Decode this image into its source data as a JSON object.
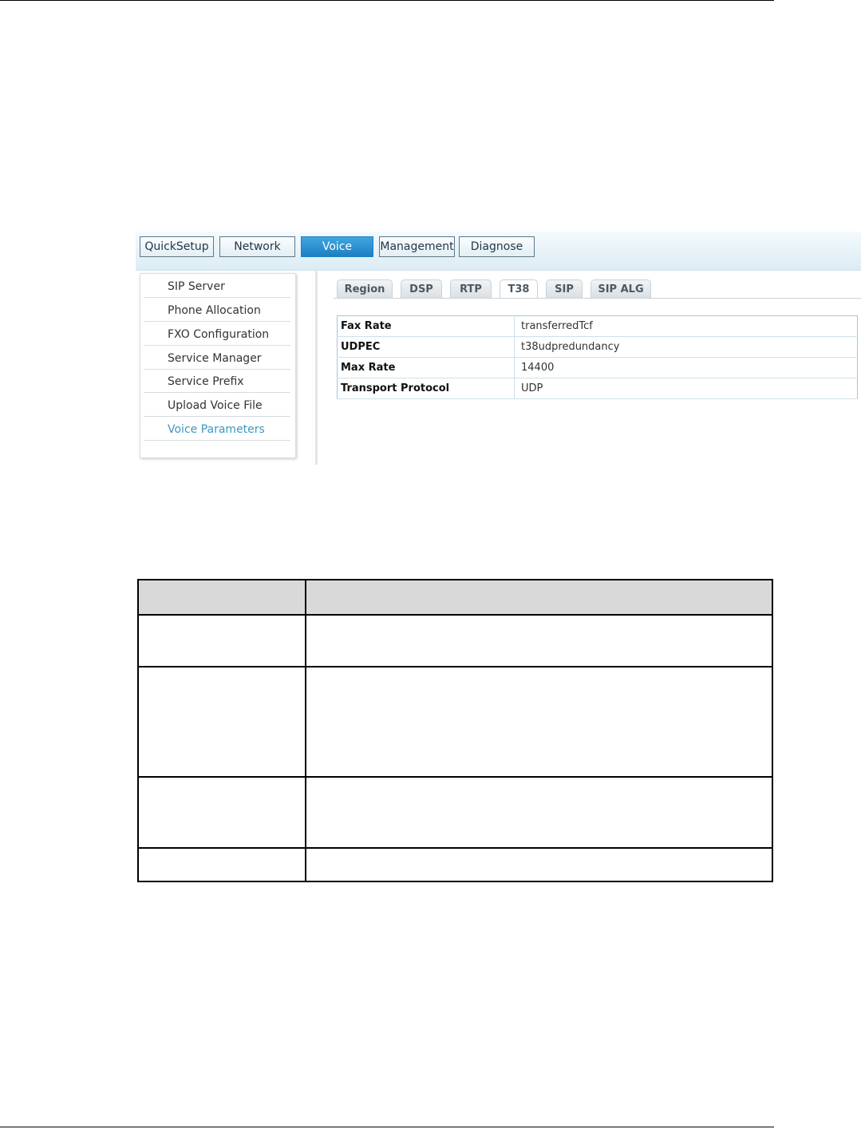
{
  "nav": {
    "items": [
      {
        "label": "QuickSetup",
        "active": false
      },
      {
        "label": "Network",
        "active": false
      },
      {
        "label": "Voice",
        "active": true
      },
      {
        "label": "Management",
        "active": false
      },
      {
        "label": "Diagnose",
        "active": false
      }
    ]
  },
  "sidebar": {
    "items": [
      {
        "label": "SIP Server"
      },
      {
        "label": "Phone Allocation"
      },
      {
        "label": "FXO Configuration"
      },
      {
        "label": "Service Manager"
      },
      {
        "label": "Service Prefix"
      },
      {
        "label": "Upload Voice File"
      },
      {
        "label": "Voice Parameters",
        "active": true
      }
    ]
  },
  "tabs": [
    {
      "label": "Region"
    },
    {
      "label": "DSP"
    },
    {
      "label": "RTP"
    },
    {
      "label": "T38",
      "active": true
    },
    {
      "label": "SIP"
    },
    {
      "label": "SIP ALG"
    }
  ],
  "params": [
    {
      "label": "Fax Rate",
      "value": "transferredTcf"
    },
    {
      "label": "UDPEC",
      "value": "t38udpredundancy"
    },
    {
      "label": "Max Rate",
      "value": "14400"
    },
    {
      "label": "Transport Protocol",
      "value": "UDP"
    }
  ],
  "colors": {
    "accent": "#1d7fc2",
    "sidebar_active": "#3b97c2",
    "header_bg": "#d9d9d9"
  }
}
